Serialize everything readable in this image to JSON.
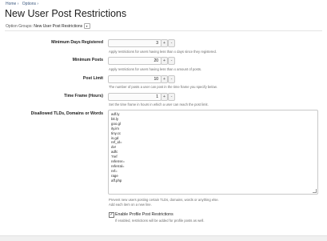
{
  "breadcrumb": [
    "Home ›",
    "Options ›"
  ],
  "page_title": "New User Post Restrictions",
  "option_groups": {
    "label": "Option Groups:",
    "value": "New User Post Restrictions"
  },
  "fields": {
    "min_days": {
      "label": "Minimum Days Registered",
      "value": "3",
      "hint": "Apply restrictions for users having less than x days since they registered."
    },
    "min_posts": {
      "label": "Minimum Posts",
      "value": "20",
      "hint": "Apply restrictions for users having less than x amount of posts."
    },
    "post_limit": {
      "label": "Post Limit",
      "value": "10",
      "hint": "The number of posts a user can post in the time frame you specify below."
    },
    "time_frame": {
      "label": "Time Frame (Hours)",
      "value": "1",
      "hint": "Set the time frame in hours in which a user can reach the post limit."
    }
  },
  "stepper": {
    "plus": "+",
    "minus": "-"
  },
  "disallowed": {
    "label": "Disallowed TLDs, Domains or Words",
    "lines": [
      "adf.ly",
      "bit.ly",
      "goo.gl",
      "ity.im",
      "tiny.cc",
      "is.gd",
      "ref_id=",
      "dvr",
      "adfc",
      "?ref",
      "referrer=",
      "referral=",
      "ref=",
      "rage",
      "aff.php"
    ],
    "hint1": "Prevent new users posting certain TLDs, domains, words or anything else.",
    "hint2": "Add each item on a new line."
  },
  "profile": {
    "checked": true,
    "label": "Enable Profile Post Restrictions",
    "hint": "If enabled, restrictions will be added for profile posts as well."
  }
}
